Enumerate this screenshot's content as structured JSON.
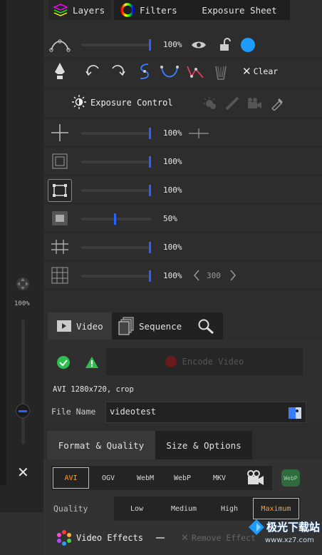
{
  "tabs": {
    "layers": "Layers",
    "filters": "Filters",
    "exposure_sheet": "Exposure Sheet"
  },
  "sidebar": {
    "zoom_value": "100%"
  },
  "opacity_row": {
    "value": "100%"
  },
  "tools": {
    "clear_label": "Clear"
  },
  "exposure": {
    "label": "Exposure Control"
  },
  "guide_rows": [
    {
      "icon": "crosshair-icon",
      "value": "100%",
      "slider": 1.0
    },
    {
      "icon": "safe-frame-icon",
      "value": "100%",
      "slider": 1.0
    },
    {
      "icon": "frame-corners-icon",
      "value": "100%",
      "slider": 1.0
    },
    {
      "icon": "mask-icon",
      "value": "50%",
      "slider": 0.5
    },
    {
      "icon": "small-grid-icon",
      "value": "100%",
      "slider": 1.0
    },
    {
      "icon": "large-grid-icon",
      "value": "100%",
      "slider": 1.0
    }
  ],
  "grid_stepper": {
    "value": "300"
  },
  "export_tabs": {
    "video": "Video",
    "sequence": "Sequence"
  },
  "encode": {
    "label": "Encode Video",
    "info": "AVI 1280x720, crop"
  },
  "file_name": {
    "label": "File Name",
    "value": "videotest"
  },
  "format_tabs": {
    "format_quality": "Format & Quality",
    "size_options": "Size & Options"
  },
  "formats": [
    "AVI",
    "OGV",
    "WebM",
    "WebP",
    "MKV"
  ],
  "webp_badge": "WebP",
  "quality": {
    "label": "Quality",
    "options": [
      "Low",
      "Medium",
      "High",
      "Maximum"
    ],
    "selected": "Maximum"
  },
  "effects": {
    "video_effects": "Video Effects",
    "remove_effect": "Remove Effect"
  },
  "watermark": {
    "site": "www.xz7.com",
    "brand": "极光下载站"
  },
  "colors": {
    "accent_blue": "#2962ff",
    "dot_blue": "#1e9bff",
    "selected_orange": "#ff9d2e",
    "green": "#2ebd4f"
  }
}
